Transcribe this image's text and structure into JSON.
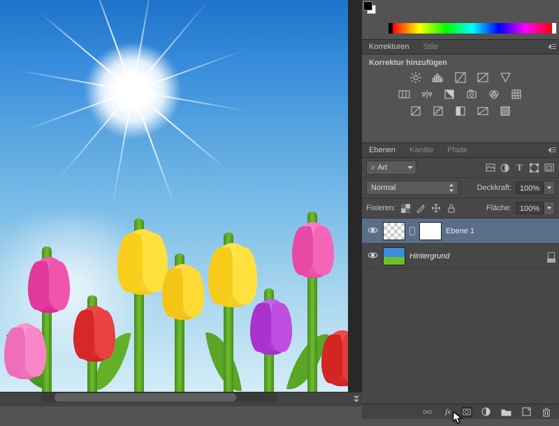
{
  "panels": {
    "corrections": {
      "tab_corrections": "Korrekturen",
      "tab_styles": "Stile",
      "add_correction": "Korrektur hinzufügen"
    },
    "layers_head": {
      "tab_layers": "Ebenen",
      "tab_channels": "Kanäle",
      "tab_paths": "Pfade"
    }
  },
  "filter": {
    "kind": "Art",
    "search_glyph": "⌕"
  },
  "blend": {
    "mode": "Normal",
    "opacity_label": "Deckkraft:",
    "opacity_value": "100%"
  },
  "lock": {
    "label": "Fixieren:",
    "fill_label": "Fläche:",
    "fill_value": "100%"
  },
  "layers": [
    {
      "name": "Ebene 1",
      "italic": false,
      "selected": true,
      "has_mask": true,
      "thumb": "transp",
      "locked": false
    },
    {
      "name": "Hintergrund",
      "italic": true,
      "selected": false,
      "has_mask": false,
      "thumb": "small",
      "locked": true
    }
  ],
  "bottom_icons": [
    "link",
    "fx",
    "mask",
    "adjust",
    "group",
    "new",
    "trash"
  ],
  "fx_label": "fx"
}
